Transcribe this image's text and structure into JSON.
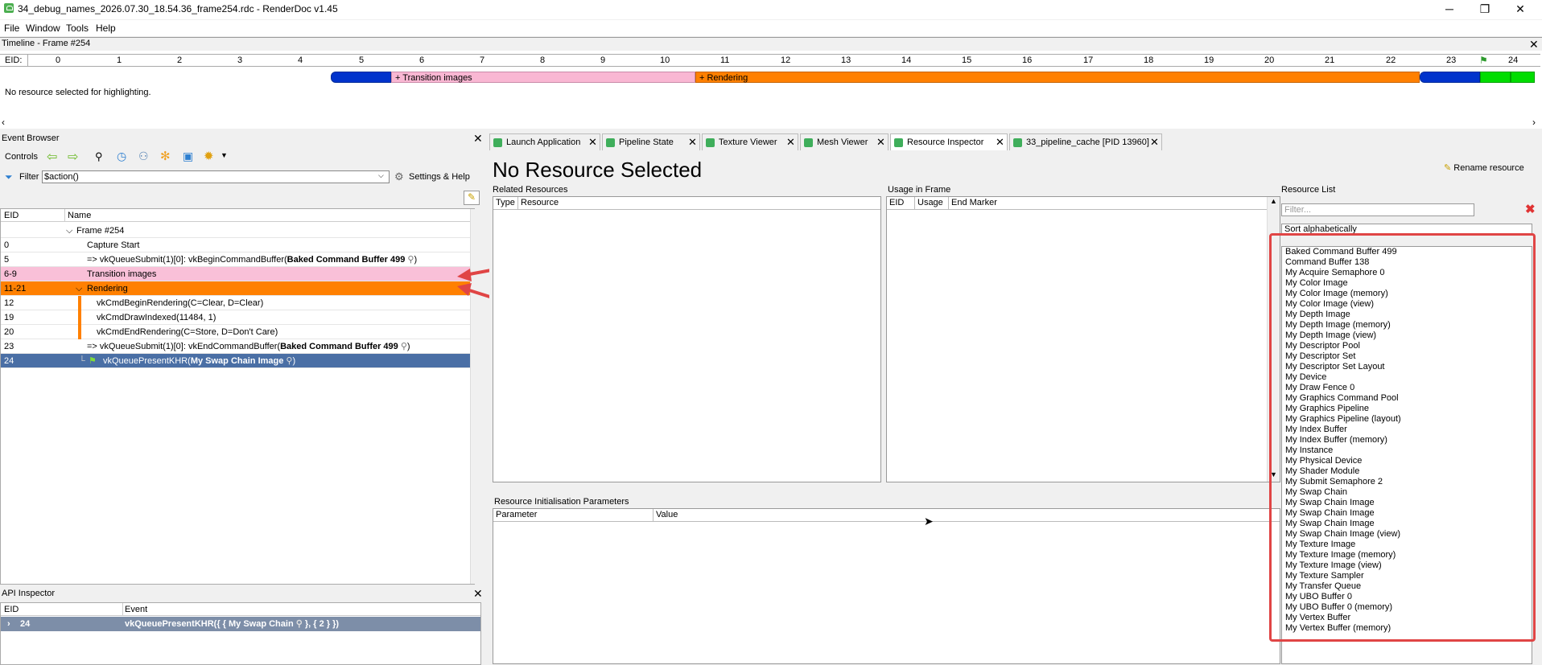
{
  "window": {
    "title": "34_debug_names_2026.07.30_18.54.36_frame254.rdc - RenderDoc v1.45",
    "minimize": "─",
    "maximize": "❐",
    "close": "✕"
  },
  "menu": [
    "File",
    "Window",
    "Tools",
    "Help"
  ],
  "timeline": {
    "title": "Timeline - Frame #254",
    "eid_label": "EID:",
    "ticks": [
      "0",
      "1",
      "2",
      "3",
      "4",
      "5",
      "6",
      "7",
      "8",
      "9",
      "10",
      "11",
      "12",
      "13",
      "14",
      "15",
      "16",
      "17",
      "18",
      "19",
      "20",
      "21",
      "22",
      "23",
      "24"
    ],
    "markers": [
      {
        "label": "",
        "color": "#0033cc"
      },
      {
        "label": "+ Transition images",
        "color": "#f9b7d3"
      },
      {
        "label": "+ Rendering",
        "color": "#ff8000"
      },
      {
        "label": "",
        "color": "#0033cc"
      },
      {
        "label": "",
        "color": "#00dd00"
      },
      {
        "label": "",
        "color": "#00dd00"
      }
    ],
    "status": "No resource selected for highlighting."
  },
  "event_browser": {
    "title": "Event Browser",
    "controls_label": "Controls",
    "filter_label": "Filter",
    "filter_value": "$action()",
    "settings_label": "Settings & Help",
    "columns": [
      "EID",
      "Name"
    ],
    "rows": [
      {
        "eid": "",
        "name": "Frame #254",
        "style": "frame"
      },
      {
        "eid": "0",
        "name": "Capture Start",
        "style": "normal"
      },
      {
        "eid": "5",
        "name": "=> vkQueueSubmit(1)[0]: vkBeginCommandBuffer(",
        "bold": "Baked Command Buffer 499",
        "suffix": ")",
        "style": "normal"
      },
      {
        "eid": "6-9",
        "name": "Transition images",
        "style": "pink"
      },
      {
        "eid": "11-21",
        "name": "Rendering",
        "style": "orange"
      },
      {
        "eid": "12",
        "name": "vkCmdBeginRendering(C=Clear, D=Clear)",
        "style": "child"
      },
      {
        "eid": "19",
        "name": "vkCmdDrawIndexed(11484, 1)",
        "style": "child"
      },
      {
        "eid": "20",
        "name": "vkCmdEndRendering(C=Store, D=Don't Care)",
        "style": "child"
      },
      {
        "eid": "23",
        "name": "=> vkQueueSubmit(1)[0]: vkEndCommandBuffer(",
        "bold": "Baked Command Buffer 499",
        "suffix": ")",
        "style": "normal"
      },
      {
        "eid": "24",
        "name": "vkQueuePresentKHR(",
        "bold": "My Swap Chain Image",
        "suffix": ")",
        "style": "selected"
      }
    ]
  },
  "api_inspector": {
    "title": "API Inspector",
    "columns": [
      "EID",
      "Event"
    ],
    "row": {
      "eid": "24",
      "event_prefix": "vkQueuePresentKHR({ { My Swap Chain",
      "event_suffix": "}, { 2 } })"
    }
  },
  "tabs": [
    {
      "label": "Launch Application",
      "active": false
    },
    {
      "label": "Pipeline State",
      "active": false
    },
    {
      "label": "Texture Viewer",
      "active": false
    },
    {
      "label": "Mesh Viewer",
      "active": false
    },
    {
      "label": "Resource Inspector",
      "active": true
    },
    {
      "label": "33_pipeline_cache [PID 13960]",
      "active": false
    }
  ],
  "resource_inspector": {
    "heading": "No Resource Selected",
    "rename_label": "Rename resource",
    "related": {
      "title": "Related Resources",
      "columns": [
        "Type",
        "Resource"
      ]
    },
    "usage": {
      "title": "Usage in Frame",
      "columns": [
        "EID",
        "Usage",
        "End Marker"
      ]
    },
    "init_params": {
      "title": "Resource Initialisation Parameters",
      "columns": [
        "Parameter",
        "Value"
      ]
    },
    "resource_list": {
      "title": "Resource List",
      "filter_placeholder": "Filter...",
      "sort_label": "Sort alphabetically",
      "items": [
        "Baked Command Buffer 499",
        "Command Buffer 138",
        "My Acquire Semaphore 0",
        "My Color Image",
        "My Color Image (memory)",
        "My Color Image (view)",
        "My Depth Image",
        "My Depth Image (memory)",
        "My Depth Image (view)",
        "My Descriptor Pool",
        "My Descriptor Set",
        "My Descriptor Set Layout",
        "My Device",
        "My Draw Fence 0",
        "My Graphics Command Pool",
        "My Graphics Pipeline",
        "My Graphics Pipeline (layout)",
        "My Index Buffer",
        "My Index Buffer (memory)",
        "My Instance",
        "My Physical Device",
        "My Shader Module",
        "My Submit Semaphore 2",
        "My Swap Chain",
        "My Swap Chain Image",
        "My Swap Chain Image",
        "My Swap Chain Image",
        "My Swap Chain Image (view)",
        "My Texture Image",
        "My Texture Image (memory)",
        "My Texture Image (view)",
        "My Texture Sampler",
        "My Transfer Queue",
        "My UBO Buffer 0",
        "My UBO Buffer 0 (memory)",
        "My Vertex Buffer",
        "My Vertex Buffer (memory)"
      ]
    }
  },
  "colors": {
    "pink_row": "#f9c0d8",
    "orange_row": "#ff8000",
    "selected_row": "#4a6fa5",
    "annotation_red": "#e04545"
  }
}
